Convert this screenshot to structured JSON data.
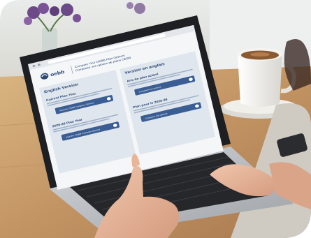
{
  "colors": {
    "background": "#ffffff",
    "table_wood": "#c9a06a",
    "laptop_silver": "#b9bcc0",
    "screen_bezel": "#1e1f22",
    "keyboard": "#26272b",
    "oebb_navy": "#2c4877",
    "oebb_panel": "#dfe6ee",
    "oebb_button": "#3a5d93",
    "mug_white": "#f4f2ee",
    "coffee": "#8a5a33",
    "flowers": "#6b4a87",
    "skin": "#e7b79b"
  },
  "screen": {
    "brand": "oebb",
    "title_en": "Compare Your OEBB Plan Options",
    "title_fr": "Comparez vos options de plans OEBB",
    "english_heading": "English Version",
    "french_heading": "Version en anglais",
    "current_plan_en": "Current Plan Year",
    "next_plan_en": "2026-28 Plan Year",
    "current_plan_fr": "Ans de plan actuel",
    "next_plan_fr": "Plan pour le 2026-28",
    "current_plan_button_en": "Visit the OEBB Compare Options",
    "next_plan_button_en": "Visit the OEBB Compare Options",
    "current_plan_button_fr": "Comparer les options",
    "next_plan_button_fr": "Comparer les options"
  },
  "icons": [
    "flowers-icon",
    "coffee-mug-icon",
    "laptop-icon",
    "oebb-logo-icon",
    "arrow-right-icon"
  ]
}
